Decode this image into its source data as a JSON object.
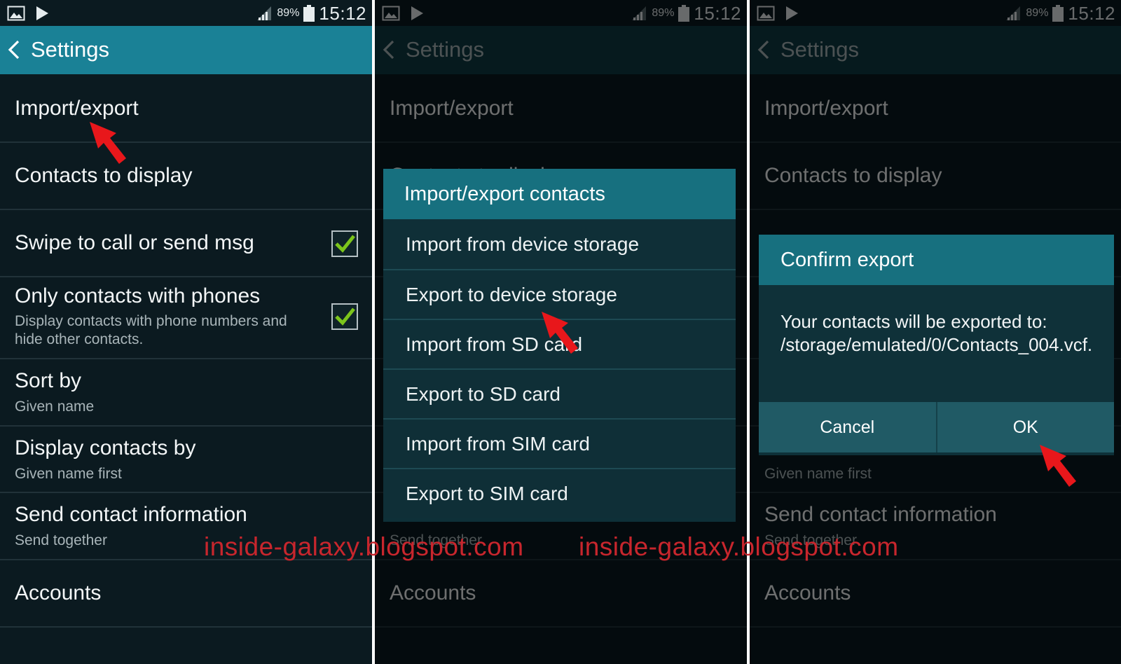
{
  "status_bar": {
    "battery": "89%",
    "time": "15:12"
  },
  "app_bar": {
    "title": "Settings"
  },
  "settings": {
    "import_export": "Import/export",
    "contacts_to_display": "Contacts to display",
    "swipe_to_call": "Swipe to call or send msg",
    "only_contacts_with_phones": "Only contacts with phones",
    "only_contacts_sub": "Display contacts with phone numbers and hide other contacts.",
    "sort_by": "Sort by",
    "sort_by_value": "Given name",
    "display_contacts_by": "Display contacts by",
    "display_contacts_by_value": "Given name first",
    "send_contact_info": "Send contact information",
    "send_contact_info_value": "Send together",
    "accounts": "Accounts"
  },
  "import_export_dialog": {
    "title": "Import/export contacts",
    "options": [
      "Import from device storage",
      "Export to device storage",
      "Import from SD card",
      "Export to SD card",
      "Import from SIM card",
      "Export to SIM card"
    ]
  },
  "confirm_dialog": {
    "title": "Confirm export",
    "message": "Your contacts will be exported to: /storage/emulated/0/Contacts_004.vcf.",
    "cancel": "Cancel",
    "ok": "OK"
  },
  "watermark": {
    "text": "inside-galaxy.blogspot.com"
  },
  "colors": {
    "background": "#0b1a20",
    "app_bar": "#1a8196",
    "dialog_header": "#17707f",
    "checkmark": "#7cc51b",
    "pointer_arrow": "#e8171b",
    "watermark": "#c8262d"
  }
}
